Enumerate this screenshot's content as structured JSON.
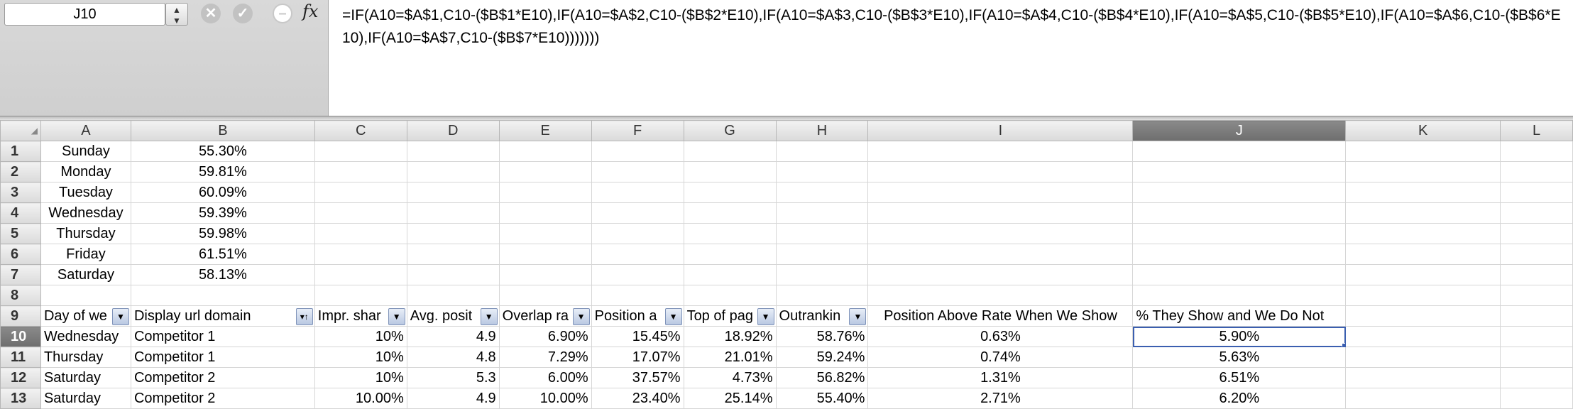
{
  "formula_bar": {
    "cell_ref": "J10",
    "fx_label": "fx",
    "formula": "=IF(A10=$A$1,C10-($B$1*E10),IF(A10=$A$2,C10-($B$2*E10),IF(A10=$A$3,C10-($B$3*E10),IF(A10=$A$4,C10-($B$4*E10),IF(A10=$A$5,C10-($B$5*E10),IF(A10=$A$6,C10-($B$6*E10),IF(A10=$A$7,C10-($B$7*E10)))))))"
  },
  "columns": [
    "A",
    "B",
    "C",
    "D",
    "E",
    "F",
    "G",
    "H",
    "I",
    "J",
    "K",
    "L"
  ],
  "selected_column": "J",
  "selected_row": "10",
  "rows": [
    {
      "num": "1",
      "cells": [
        "Sunday",
        "55.30%",
        "",
        "",
        "",
        "",
        "",
        "",
        "",
        "",
        "",
        ""
      ]
    },
    {
      "num": "2",
      "cells": [
        "Monday",
        "59.81%",
        "",
        "",
        "",
        "",
        "",
        "",
        "",
        "",
        "",
        ""
      ]
    },
    {
      "num": "3",
      "cells": [
        "Tuesday",
        "60.09%",
        "",
        "",
        "",
        "",
        "",
        "",
        "",
        "",
        "",
        ""
      ]
    },
    {
      "num": "4",
      "cells": [
        "Wednesday",
        "59.39%",
        "",
        "",
        "",
        "",
        "",
        "",
        "",
        "",
        "",
        ""
      ]
    },
    {
      "num": "5",
      "cells": [
        "Thursday",
        "59.98%",
        "",
        "",
        "",
        "",
        "",
        "",
        "",
        "",
        "",
        ""
      ]
    },
    {
      "num": "6",
      "cells": [
        "Friday",
        "61.51%",
        "",
        "",
        "",
        "",
        "",
        "",
        "",
        "",
        "",
        ""
      ]
    },
    {
      "num": "7",
      "cells": [
        "Saturday",
        "58.13%",
        "",
        "",
        "",
        "",
        "",
        "",
        "",
        "",
        "",
        ""
      ]
    },
    {
      "num": "8",
      "cells": [
        "",
        "",
        "",
        "",
        "",
        "",
        "",
        "",
        "",
        "",
        "",
        ""
      ]
    },
    {
      "num": "9",
      "cells": [
        "Day of we",
        "Display url domain",
        "Impr. shar",
        "Avg. posit",
        "Overlap ra",
        "Position a",
        "Top of pag",
        "Outrankin",
        "Position Above Rate When We Show",
        "% They Show and We Do Not",
        "",
        ""
      ]
    },
    {
      "num": "10",
      "cells": [
        "Wednesday",
        "Competitor 1",
        "10%",
        "4.9",
        "6.90%",
        "15.45%",
        "18.92%",
        "58.76%",
        "0.63%",
        "5.90%",
        "",
        ""
      ]
    },
    {
      "num": "11",
      "cells": [
        "Thursday",
        "Competitor 1",
        "10%",
        "4.8",
        "7.29%",
        "17.07%",
        "21.01%",
        "59.24%",
        "0.74%",
        "5.63%",
        "",
        ""
      ]
    },
    {
      "num": "12",
      "cells": [
        "Saturday",
        "Competitor 2",
        "10%",
        "5.3",
        "6.00%",
        "37.57%",
        "4.73%",
        "56.82%",
        "1.31%",
        "6.51%",
        "",
        ""
      ]
    },
    {
      "num": "13",
      "cells": [
        "Saturday",
        "Competitor 2",
        "10.00%",
        "4.9",
        "10.00%",
        "23.40%",
        "25.14%",
        "55.40%",
        "2.71%",
        "6.20%",
        "",
        ""
      ]
    }
  ],
  "filter_icons": {
    "A": "dropdown-arrow",
    "B": "sort-ascending-filter",
    "C": "dropdown-arrow",
    "D": "dropdown-arrow",
    "E": "dropdown-arrow",
    "F": "dropdown-arrow",
    "G": "dropdown-arrow",
    "H": "dropdown-arrow"
  },
  "colors": {
    "selection": "#3b5fb0",
    "header_selected": "#7a7a7a"
  }
}
